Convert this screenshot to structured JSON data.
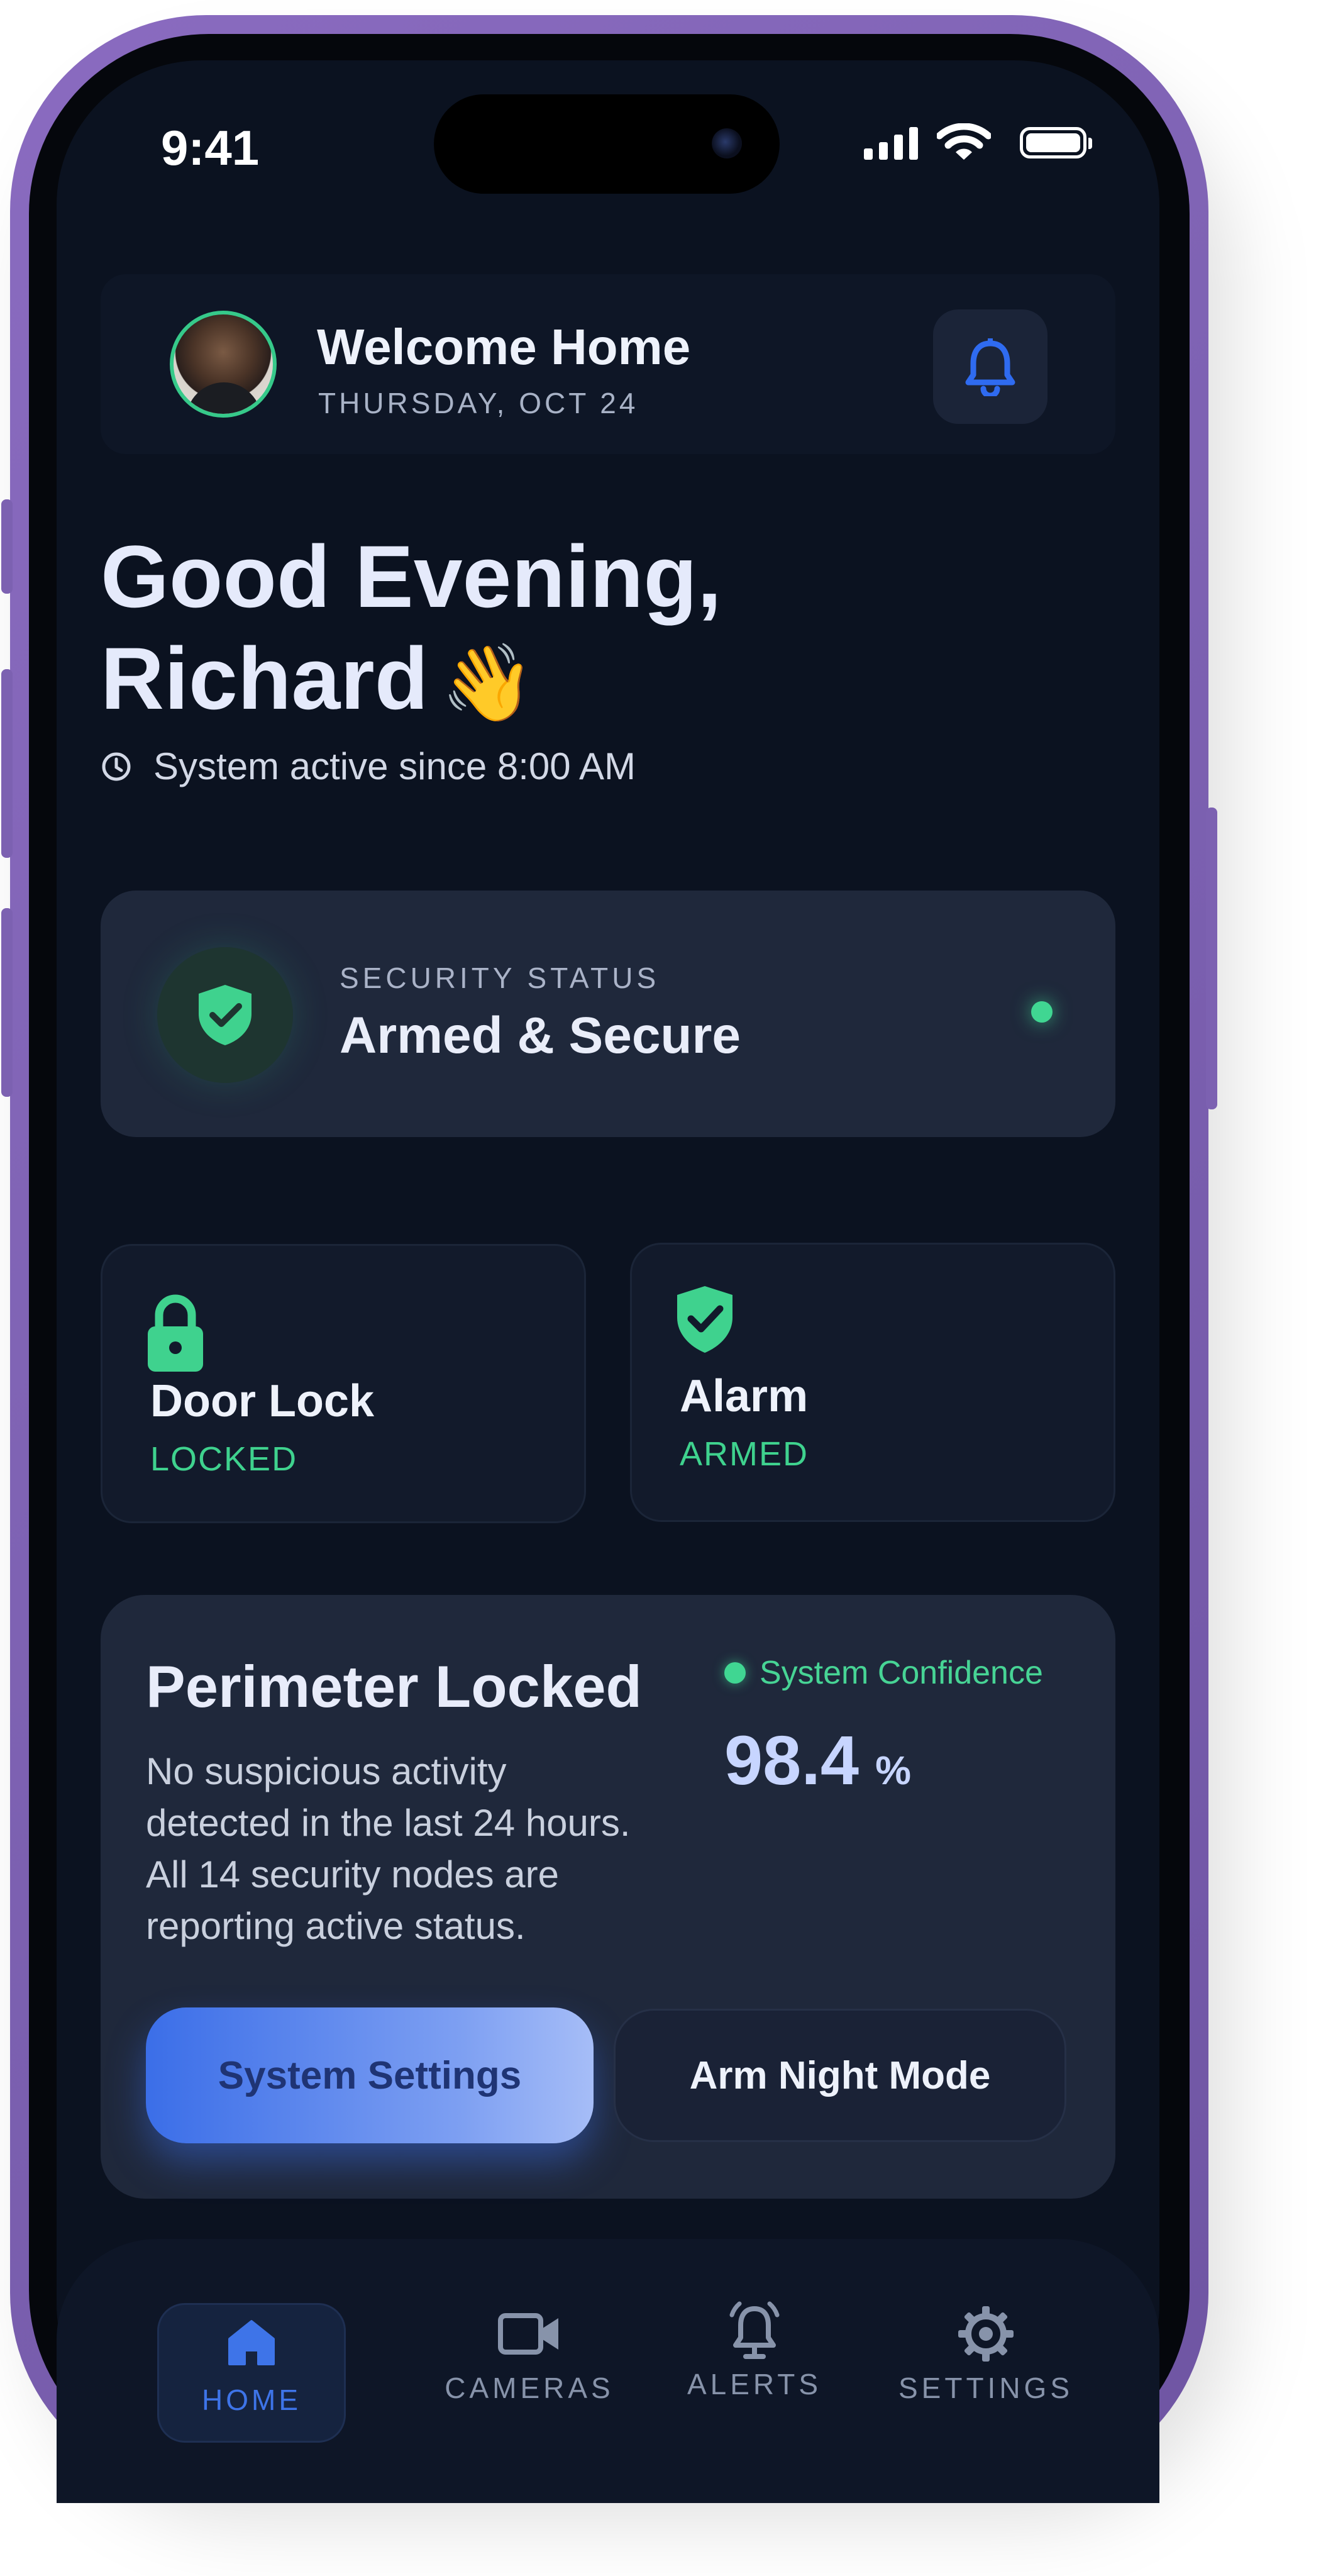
{
  "status_bar": {
    "time": "9:41"
  },
  "header": {
    "title": "Welcome Home",
    "date": "THURSDAY, OCT 24",
    "notification_icon": "bell-icon"
  },
  "greeting": {
    "line1": "Good Evening,",
    "name": "Richard",
    "emoji": "👋",
    "system_status": "System active since 8:00 AM"
  },
  "security_status": {
    "label": "SECURITY STATUS",
    "value": "Armed & Secure",
    "icon": "shield-check-icon",
    "indicator_color": "#40d692"
  },
  "tiles": [
    {
      "title": "Door Lock",
      "state": "LOCKED",
      "icon": "lock-icon"
    },
    {
      "title": "Alarm",
      "state": "ARMED",
      "icon": "shield-check-icon"
    }
  ],
  "perimeter": {
    "title": "Perimeter Locked",
    "description": "No suspicious activity detected in the last 24 hours. All 14 security nodes are reporting active status.",
    "confidence_label": "System Confidence",
    "confidence_value": "98.4",
    "confidence_unit": "%",
    "primary_button": "System Settings",
    "secondary_button": "Arm Night Mode"
  },
  "nav": {
    "items": [
      {
        "label": "HOME",
        "icon": "home-icon",
        "active": true
      },
      {
        "label": "CAMERAS",
        "icon": "video-camera-icon",
        "active": false
      },
      {
        "label": "ALERTS",
        "icon": "alarm-bell-icon",
        "active": false
      },
      {
        "label": "SETTINGS",
        "icon": "gear-icon",
        "active": false
      }
    ]
  },
  "colors": {
    "background": "#0b1220",
    "card": "#1f283b",
    "accent_blue": "#3e74e8",
    "accent_green": "#40d692",
    "phone_frame": "#7f63b4"
  }
}
